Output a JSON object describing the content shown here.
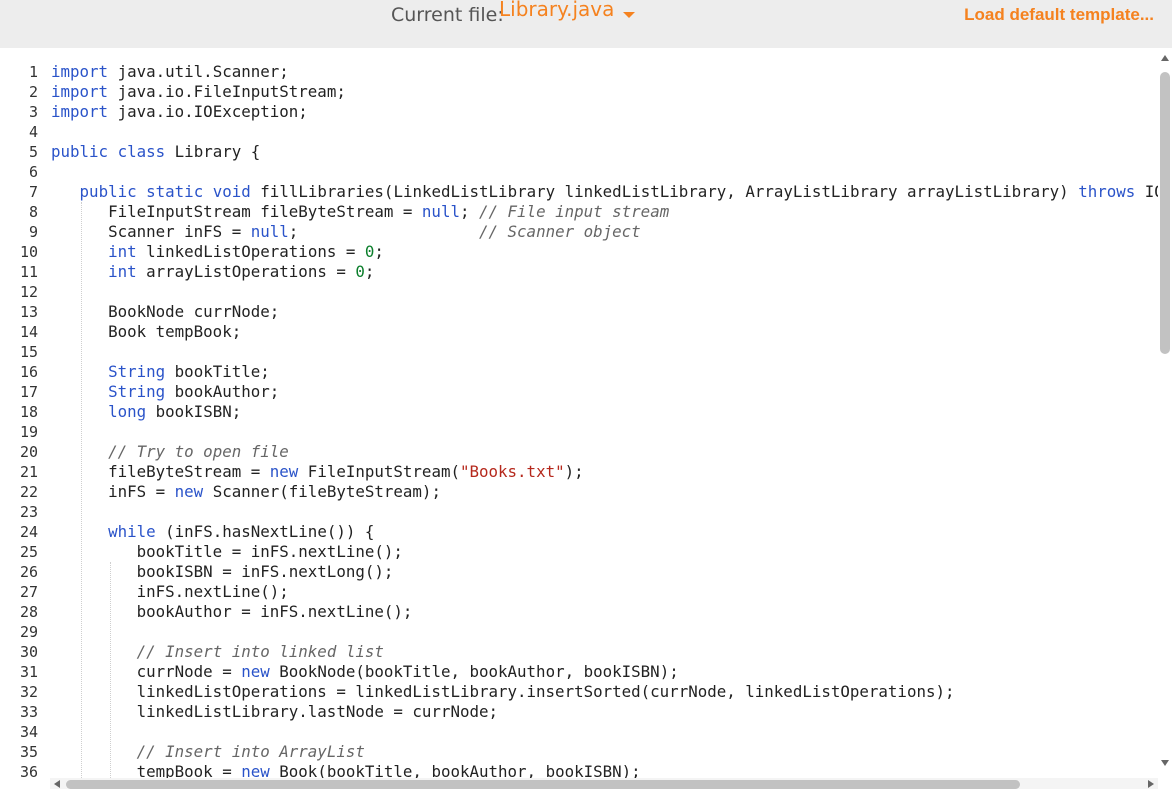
{
  "header": {
    "file_label": "Current file:",
    "file_name": "Library.java",
    "load_label": "Load default template..."
  },
  "colors": {
    "accent": "#f5821f",
    "keyword": "#2a53c9",
    "comment": "#666666",
    "string": "#b5281c",
    "number": "#0b7e2b"
  },
  "icons": {
    "file_dropdown": "caret-down-icon",
    "scroll_up": "arrow-up-icon",
    "scroll_down": "arrow-down-icon",
    "scroll_left": "arrow-left-icon",
    "scroll_right": "arrow-right-icon"
  },
  "editor": {
    "lines": [
      {
        "n": "1",
        "t": "import java.util.Scanner;"
      },
      {
        "n": "2",
        "t": "import java.io.FileInputStream;"
      },
      {
        "n": "3",
        "t": "import java.io.IOException;"
      },
      {
        "n": "4",
        "t": ""
      },
      {
        "n": "5",
        "t": "public class Library {"
      },
      {
        "n": "6",
        "t": ""
      },
      {
        "n": "7",
        "t": "   public static void fillLibraries(LinkedListLibrary linkedListLibrary, ArrayListLibrary arrayListLibrary) throws IOException {"
      },
      {
        "n": "8",
        "t": "      FileInputStream fileByteStream = null; // File input stream"
      },
      {
        "n": "9",
        "t": "      Scanner inFS = null;                   // Scanner object"
      },
      {
        "n": "10",
        "t": "      int linkedListOperations = 0;"
      },
      {
        "n": "11",
        "t": "      int arrayListOperations = 0;"
      },
      {
        "n": "12",
        "t": ""
      },
      {
        "n": "13",
        "t": "      BookNode currNode;"
      },
      {
        "n": "14",
        "t": "      Book tempBook;"
      },
      {
        "n": "15",
        "t": ""
      },
      {
        "n": "16",
        "t": "      String bookTitle;"
      },
      {
        "n": "17",
        "t": "      String bookAuthor;"
      },
      {
        "n": "18",
        "t": "      long bookISBN;"
      },
      {
        "n": "19",
        "t": ""
      },
      {
        "n": "20",
        "t": "      // Try to open file"
      },
      {
        "n": "21",
        "t": "      fileByteStream = new FileInputStream(\"Books.txt\");"
      },
      {
        "n": "22",
        "t": "      inFS = new Scanner(fileByteStream);"
      },
      {
        "n": "23",
        "t": ""
      },
      {
        "n": "24",
        "t": "      while (inFS.hasNextLine()) {"
      },
      {
        "n": "25",
        "t": "         bookTitle = inFS.nextLine();"
      },
      {
        "n": "26",
        "t": "         bookISBN = inFS.nextLong();"
      },
      {
        "n": "27",
        "t": "         inFS.nextLine();"
      },
      {
        "n": "28",
        "t": "         bookAuthor = inFS.nextLine();"
      },
      {
        "n": "29",
        "t": ""
      },
      {
        "n": "30",
        "t": "         // Insert into linked list"
      },
      {
        "n": "31",
        "t": "         currNode = new BookNode(bookTitle, bookAuthor, bookISBN);"
      },
      {
        "n": "32",
        "t": "         linkedListOperations = linkedListLibrary.insertSorted(currNode, linkedListOperations);"
      },
      {
        "n": "33",
        "t": "         linkedListLibrary.lastNode = currNode;"
      },
      {
        "n": "34",
        "t": ""
      },
      {
        "n": "35",
        "t": "         // Insert into ArrayList"
      },
      {
        "n": "36",
        "t": "         tempBook = new Book(bookTitle, bookAuthor, bookISBN);"
      }
    ]
  }
}
